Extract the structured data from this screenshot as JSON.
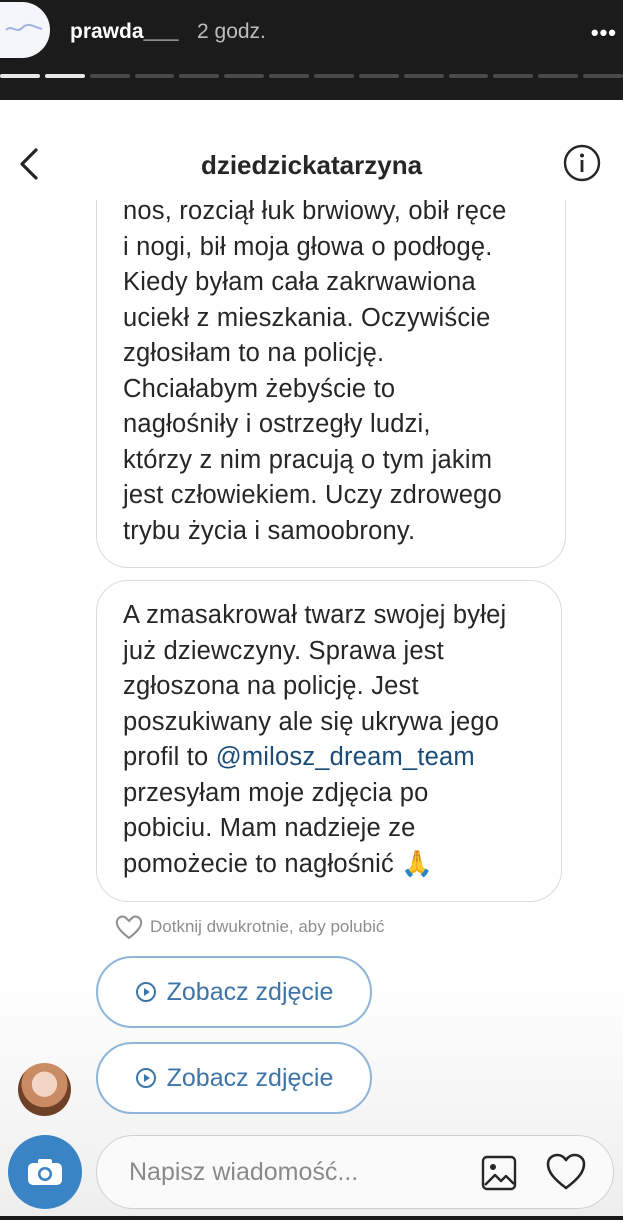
{
  "story": {
    "username": "prawda___",
    "time": "2 godz.",
    "more": "•••",
    "progress_total": 14,
    "progress_current": 2
  },
  "dm": {
    "title": "dziedzickatarzyna",
    "message1_lines": [
      "nos, rozciął łuk brwiowy, obił ręce",
      "i nogi, bił moja głowa o podłogę.",
      "Kiedy byłam cała zakrwawiona",
      "uciekł z mieszkania. Oczywiście",
      "zgłosiłam to na policję.",
      "Chciałabym żebyście to",
      "nagłośniły i ostrzegły ludzi,",
      "którzy z nim pracują o tym jakim",
      "jest człowiekiem. Uczy zdrowego",
      "trybu życia i samoobrony."
    ],
    "message2_lines": [
      "A zmasakrował twarz swojej byłej",
      "już dziewczyny. Sprawa jest",
      "zgłoszona na policję. Jest",
      "poszukiwany ale się ukrywa jego",
      "profil to",
      "przesyłam moje zdjęcia po",
      "pobiciu. Mam nadzieje ze",
      "pomożecie to nagłośnić 🙏"
    ],
    "mention": "@milosz_dream_team",
    "like_hint": "Dotknij dwukrotnie, aby polubić",
    "photo_button_1": "Zobacz zdjęcie",
    "photo_button_2": "Zobacz zdjęcie",
    "composer_placeholder": "Napisz wiadomość..."
  },
  "colors": {
    "link": "#1b4c78",
    "accent": "#3a83c4",
    "button_text": "#3e75a8"
  },
  "icons": [
    "back-icon",
    "info-icon",
    "heart-icon",
    "play-icon",
    "camera-icon",
    "gallery-icon",
    "more-icon"
  ]
}
